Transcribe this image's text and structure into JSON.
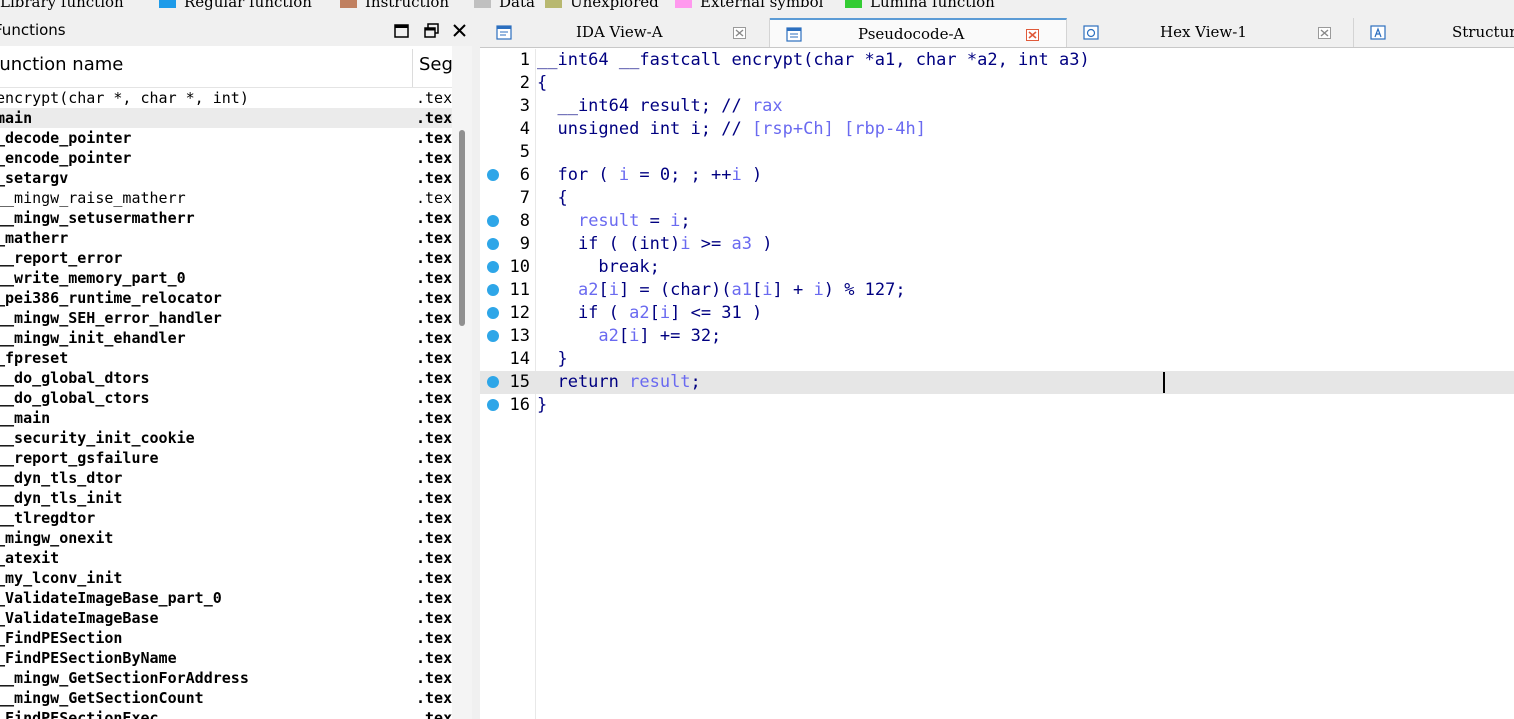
{
  "legend": [
    {
      "label": "Library function",
      "color": "#7ec8e3"
    },
    {
      "label": "Regular function",
      "color": "#1e9be9"
    },
    {
      "label": "Instruction",
      "color": "#c08060"
    },
    {
      "label": "Data",
      "color": "#c0c0c0"
    },
    {
      "label": "Unexplored",
      "color": "#b8b870"
    },
    {
      "label": "External symbol",
      "color": "#ff99ee"
    },
    {
      "label": "Lumina function",
      "color": "#33cc33"
    }
  ],
  "functions_panel": {
    "title": "Functions",
    "col_name": "Function name",
    "col_segment": "Segment",
    "rows": [
      {
        "name": "encrypt(char *, char *, int)",
        "seg": ".text",
        "lib": true
      },
      {
        "name": "main",
        "seg": ".text",
        "selected": true
      },
      {
        "name": "_decode_pointer",
        "seg": ".text"
      },
      {
        "name": "_encode_pointer",
        "seg": ".text"
      },
      {
        "name": "_setargv",
        "seg": ".text"
      },
      {
        "name": "__mingw_raise_matherr",
        "seg": ".text",
        "lib": true
      },
      {
        "name": "__mingw_setusermatherr",
        "seg": ".text"
      },
      {
        "name": "_matherr",
        "seg": ".text"
      },
      {
        "name": "__report_error",
        "seg": ".text"
      },
      {
        "name": "__write_memory_part_0",
        "seg": ".text"
      },
      {
        "name": "_pei386_runtime_relocator",
        "seg": ".text"
      },
      {
        "name": "__mingw_SEH_error_handler",
        "seg": ".text"
      },
      {
        "name": "__mingw_init_ehandler",
        "seg": ".text"
      },
      {
        "name": "_fpreset",
        "seg": ".text"
      },
      {
        "name": "__do_global_dtors",
        "seg": ".text"
      },
      {
        "name": "__do_global_ctors",
        "seg": ".text"
      },
      {
        "name": "__main",
        "seg": ".text"
      },
      {
        "name": "__security_init_cookie",
        "seg": ".text"
      },
      {
        "name": "__report_gsfailure",
        "seg": ".text"
      },
      {
        "name": "__dyn_tls_dtor",
        "seg": ".text"
      },
      {
        "name": "__dyn_tls_init",
        "seg": ".text"
      },
      {
        "name": "__tlregdtor",
        "seg": ".text"
      },
      {
        "name": "_mingw_onexit",
        "seg": ".text"
      },
      {
        "name": "_atexit",
        "seg": ".text"
      },
      {
        "name": "_my_lconv_init",
        "seg": ".text"
      },
      {
        "name": "_ValidateImageBase_part_0",
        "seg": ".text"
      },
      {
        "name": "_ValidateImageBase",
        "seg": ".text"
      },
      {
        "name": "_FindPESection",
        "seg": ".text"
      },
      {
        "name": "_FindPESectionByName",
        "seg": ".text"
      },
      {
        "name": "__mingw_GetSectionForAddress",
        "seg": ".text"
      },
      {
        "name": "__mingw_GetSectionCount",
        "seg": ".text"
      },
      {
        "name": "_FindPESectionExec",
        "seg": ".text"
      }
    ]
  },
  "tabs": [
    {
      "label": "IDA View-A",
      "icon": "ida-view-icon",
      "active": false
    },
    {
      "label": "Pseudocode-A",
      "icon": "pseudocode-icon",
      "active": true
    },
    {
      "label": "Hex View-1",
      "icon": "hex-view-icon",
      "active": false
    },
    {
      "label": "Structures",
      "icon": "structures-icon",
      "active": false
    }
  ],
  "code": [
    {
      "n": "1",
      "bp": false,
      "segs": [
        [
          "k",
          "__int64 __fastcall encrypt(char *a1, char *a2, int a3)"
        ]
      ]
    },
    {
      "n": "2",
      "bp": false,
      "segs": [
        [
          "k",
          "{"
        ]
      ]
    },
    {
      "n": "3",
      "bp": false,
      "segs": [
        [
          "k",
          "  __int64 result; // "
        ],
        [
          "v",
          "rax"
        ]
      ]
    },
    {
      "n": "4",
      "bp": false,
      "segs": [
        [
          "k",
          "  unsigned int i; // "
        ],
        [
          "v",
          "[rsp+Ch] [rbp-4h]"
        ]
      ]
    },
    {
      "n": "5",
      "bp": false,
      "segs": [
        [
          "k",
          ""
        ]
      ]
    },
    {
      "n": "6",
      "bp": true,
      "segs": [
        [
          "k",
          "  for ( "
        ],
        [
          "v",
          "i"
        ],
        [
          "k",
          " = 0; ; ++"
        ],
        [
          "v",
          "i"
        ],
        [
          "k",
          " )"
        ]
      ]
    },
    {
      "n": "7",
      "bp": false,
      "segs": [
        [
          "k",
          "  {"
        ]
      ]
    },
    {
      "n": "8",
      "bp": true,
      "segs": [
        [
          "k",
          "    "
        ],
        [
          "v",
          "result"
        ],
        [
          "k",
          " = "
        ],
        [
          "v",
          "i"
        ],
        [
          "k",
          ";"
        ]
      ]
    },
    {
      "n": "9",
      "bp": true,
      "segs": [
        [
          "k",
          "    if ( (int)"
        ],
        [
          "v",
          "i"
        ],
        [
          "k",
          " >= "
        ],
        [
          "v",
          "a3"
        ],
        [
          "k",
          " )"
        ]
      ]
    },
    {
      "n": "10",
      "bp": true,
      "segs": [
        [
          "k",
          "      break;"
        ]
      ]
    },
    {
      "n": "11",
      "bp": true,
      "segs": [
        [
          "k",
          "    "
        ],
        [
          "v",
          "a2"
        ],
        [
          "k",
          "["
        ],
        [
          "v",
          "i"
        ],
        [
          "k",
          "] = (char)("
        ],
        [
          "v",
          "a1"
        ],
        [
          "k",
          "["
        ],
        [
          "v",
          "i"
        ],
        [
          "k",
          "] + "
        ],
        [
          "v",
          "i"
        ],
        [
          "k",
          ") % 127;"
        ]
      ]
    },
    {
      "n": "12",
      "bp": true,
      "segs": [
        [
          "k",
          "    if ( "
        ],
        [
          "v",
          "a2"
        ],
        [
          "k",
          "["
        ],
        [
          "v",
          "i"
        ],
        [
          "k",
          "] <= 31 )"
        ]
      ]
    },
    {
      "n": "13",
      "bp": true,
      "segs": [
        [
          "k",
          "      "
        ],
        [
          "v",
          "a2"
        ],
        [
          "k",
          "["
        ],
        [
          "v",
          "i"
        ],
        [
          "k",
          "] += 32;"
        ]
      ]
    },
    {
      "n": "14",
      "bp": false,
      "segs": [
        [
          "k",
          "  }"
        ]
      ]
    },
    {
      "n": "15",
      "bp": true,
      "cur": true,
      "segs": [
        [
          "k",
          "  return "
        ],
        [
          "v",
          "result"
        ],
        [
          "k",
          ";"
        ]
      ]
    },
    {
      "n": "16",
      "bp": true,
      "segs": [
        [
          "k",
          "}"
        ]
      ]
    }
  ]
}
